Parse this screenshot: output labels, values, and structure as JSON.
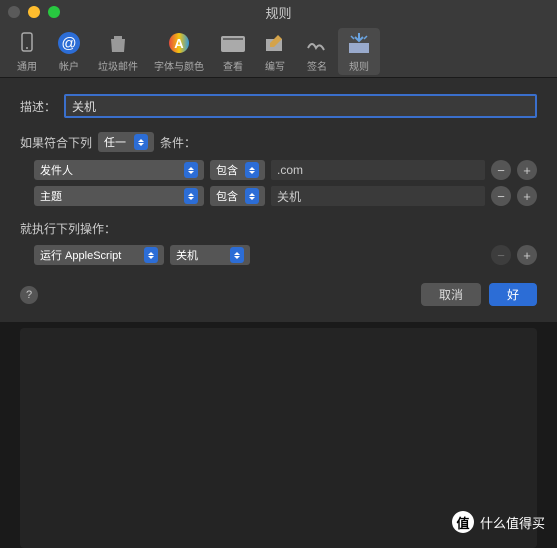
{
  "title": "规则",
  "toolbar": [
    {
      "label": "通用",
      "icon": "general"
    },
    {
      "label": "帐户",
      "icon": "accounts"
    },
    {
      "label": "垃圾邮件",
      "icon": "junk"
    },
    {
      "label": "字体与颜色",
      "icon": "fonts"
    },
    {
      "label": "查看",
      "icon": "viewing"
    },
    {
      "label": "编写",
      "icon": "composing"
    },
    {
      "label": "签名",
      "icon": "signatures"
    },
    {
      "label": "规则",
      "icon": "rules",
      "selected": true
    }
  ],
  "form": {
    "desc_label": "描述：",
    "desc_value": "关机",
    "if_prefix": "如果符合下列",
    "if_mode": "任一",
    "if_suffix": "条件：",
    "conditions": [
      {
        "field": "发件人",
        "op": "包含",
        "value": ".com"
      },
      {
        "field": "主题",
        "op": "包含",
        "value": "关机"
      }
    ],
    "then_label": "就执行下列操作：",
    "action": {
      "type": "运行 AppleScript",
      "target": "关机"
    },
    "cancel": "取消",
    "ok": "好"
  },
  "watermark": "什么值得买"
}
